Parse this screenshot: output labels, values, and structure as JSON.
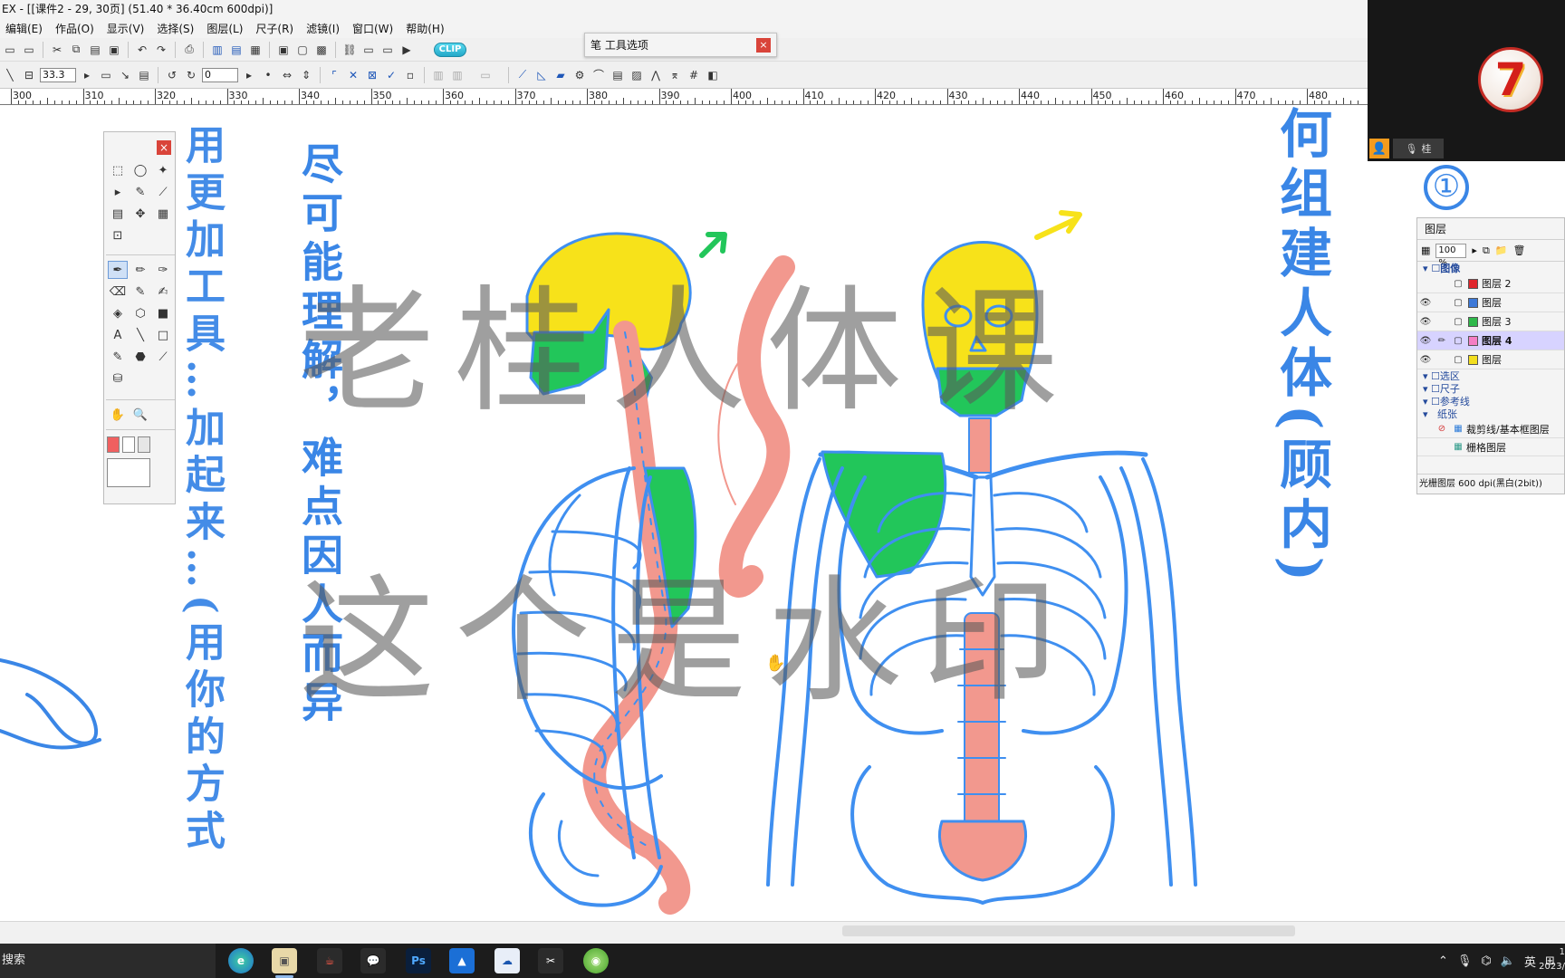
{
  "window": {
    "title": "EX - [[课件2 - 29, 30页] (51.40 * 36.40cm 600dpi)]"
  },
  "menu": [
    "编辑(E)",
    "作品(O)",
    "显示(V)",
    "选择(S)",
    "图层(L)",
    "尺子(R)",
    "滤镜(I)",
    "窗口(W)",
    "帮助(H)"
  ],
  "toolbar": {
    "zoom_value": "33.3",
    "angle_value": "0",
    "clip_badge": "CLIP"
  },
  "pen_panel": {
    "title": "笔 工具选项",
    "close": "×"
  },
  "ruler": {
    "labels": [
      "300",
      "310",
      "320",
      "330",
      "340",
      "350",
      "360",
      "370",
      "380",
      "390",
      "400",
      "410",
      "420",
      "430",
      "440",
      "450",
      "460",
      "470",
      "480"
    ]
  },
  "tool_palette": {
    "close": "×",
    "tools": [
      "⬚",
      "◯",
      "✦",
      "▸",
      "✎",
      "⟋",
      "▤",
      "✥",
      "▦",
      "⊡",
      "✒",
      "✏",
      "✑",
      "⌫",
      "✎",
      "✍",
      "◈",
      "⬡",
      "■",
      "A",
      "╲",
      "□",
      "✎",
      "⬣",
      "⟋",
      "⛁",
      "✋",
      "🔍"
    ]
  },
  "canvas": {
    "left_note_1": "用更加工具…加起来…(用你的方式",
    "left_note_2": "尽可能理解，难点因人而异",
    "right_note_circle": "①",
    "right_note_main": "何组建人体(顾内)",
    "watermark_line1": "老桂人体课",
    "watermark_line2": "这个是水印"
  },
  "webcam": {
    "logo_text": "7",
    "user_label": "桂"
  },
  "layer_panel": {
    "title": "图层",
    "opacity": "100 %",
    "folder_label": "图像",
    "layers": [
      {
        "name": "图层 2",
        "color": "#e0262c",
        "eye": "",
        "pen": "",
        "selected": false
      },
      {
        "name": "图层",
        "color": "#3d79d8",
        "eye": "👁",
        "pen": "",
        "selected": false
      },
      {
        "name": "图层 3",
        "color": "#2fb84a",
        "eye": "👁",
        "pen": "",
        "selected": false
      },
      {
        "name": "图层 4",
        "color": "#f57ec4",
        "eye": "👁",
        "pen": "✏",
        "selected": true
      },
      {
        "name": "图层",
        "color": "#f2de1f",
        "eye": "👁",
        "pen": "",
        "selected": false
      }
    ],
    "folders": [
      "选区",
      "尺子",
      "参考线",
      "纸张"
    ],
    "paper_layers": [
      "裁剪线/基本框图层",
      "栅格图层"
    ],
    "status": "光栅图层 600 dpi(黑白(2bit))"
  },
  "taskbar": {
    "search_text": "搜索",
    "ime_label": "英",
    "clock_line1": "1",
    "clock_line2": "2023/"
  },
  "colors": {
    "skeleton_blue": "#3f8ff0",
    "skull_yellow": "#f7e21a",
    "muscle_green": "#22c65a",
    "spine_pink": "#f2988e",
    "note_blue": "#3a86e6"
  }
}
